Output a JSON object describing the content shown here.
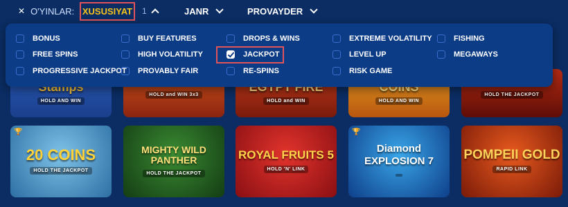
{
  "topbar": {
    "games_label": "O'YINLAR:",
    "features_tab": "XUSUSIYAT",
    "selected_count": "1",
    "genre": "JANR",
    "provider": "PROVAYDER"
  },
  "features": {
    "options": [
      {
        "label": "BONUS",
        "checked": false
      },
      {
        "label": "FREE SPINS",
        "checked": false
      },
      {
        "label": "PROGRESSIVE JACKPOT",
        "checked": false
      },
      {
        "label": "BUY FEATURES",
        "checked": false
      },
      {
        "label": "HIGH VOLATILITY",
        "checked": false
      },
      {
        "label": "PROVABLY FAIR",
        "checked": false
      },
      {
        "label": "DROPS & WINS",
        "checked": false
      },
      {
        "label": "JACKPOT",
        "checked": true
      },
      {
        "label": "RE-SPINS",
        "checked": false
      },
      {
        "label": "EXTREME VOLATILITY",
        "checked": false
      },
      {
        "label": "LEVEL UP",
        "checked": false
      },
      {
        "label": "RISK GAME",
        "checked": false
      },
      {
        "label": "FISHING",
        "checked": false
      },
      {
        "label": "MEGAWAYS",
        "checked": false
      }
    ]
  },
  "games": {
    "row1": [
      {
        "title": "Stamps",
        "sub": "HOLD AND WIN"
      },
      {
        "title": "",
        "sub": "HOLD and WIN 3x3"
      },
      {
        "title": "EGYPT FIRE",
        "sub": "HOLD and WIN"
      },
      {
        "title": "COINS",
        "sub": "HOLD AND WIN"
      },
      {
        "title": "",
        "sub": "HOLD THE JACKPOT"
      }
    ],
    "row2": [
      {
        "title": "20 COINS",
        "sub": "HOLD THE JACKPOT"
      },
      {
        "title": "MIGHTY WILD PANTHER",
        "sub": "HOLD THE JACKPOT"
      },
      {
        "title": "ROYAL FRUITS 5",
        "sub": "HOLD 'N' LINK"
      },
      {
        "title": "Diamond EXPLOSION 7",
        "sub": ""
      },
      {
        "title": "POMPEII GOLD",
        "sub": "RAPID LINK"
      }
    ]
  },
  "colors": {
    "background": "#0b2d64",
    "panel": "#0d3c86",
    "highlight": "#e0545a",
    "accent": "#f5c31c"
  }
}
